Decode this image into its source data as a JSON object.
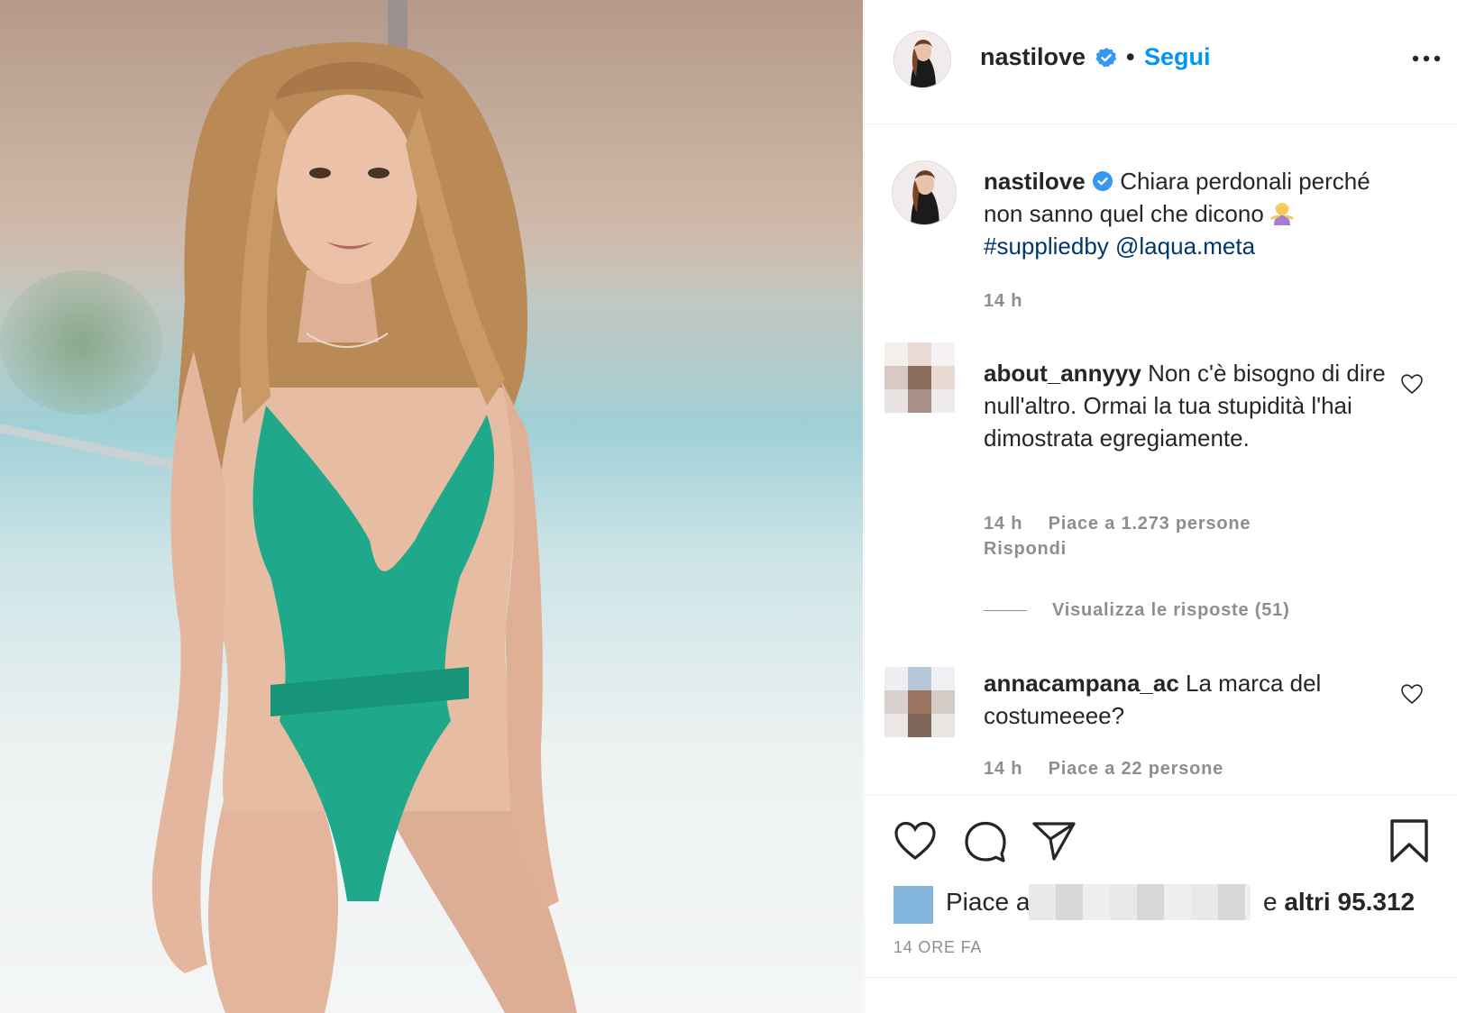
{
  "post": {
    "author": {
      "username": "nastilove",
      "verified": true,
      "follow_label": "Segui",
      "separator": "•"
    },
    "caption": {
      "username": "nastilove",
      "text": "Chiara perdonali perché non sanno quel che dicono",
      "emoji": "person-shrugging-emoji",
      "hashtag": "#suppliedby",
      "mention": "@laqua.meta",
      "time": "14 h"
    },
    "comments": [
      {
        "username": "about_annyyy",
        "text": "Non c'è bisogno di dire null'altro. Ormai la tua stupidità l'hai dimostrata egregiamente.",
        "time": "14 h",
        "likes": "Piace a 1.273 persone",
        "reply_label": "Rispondi",
        "view_replies": "Visualizza le risposte (51)"
      },
      {
        "username": "annacampana_ac",
        "text": "La marca del costumeeee?",
        "time": "14 h",
        "likes": "Piace a 22 persone"
      }
    ],
    "likes_bar": {
      "prefix": "Piace a",
      "conjunction": "e",
      "others": "altri 95.312"
    },
    "timestamp": "14 ORE FA",
    "colors": {
      "link_blue": "#0095f6",
      "verified_blue": "#3897f0",
      "hashtag_blue": "#00376b",
      "swimsuit": "#1fa98a"
    }
  }
}
